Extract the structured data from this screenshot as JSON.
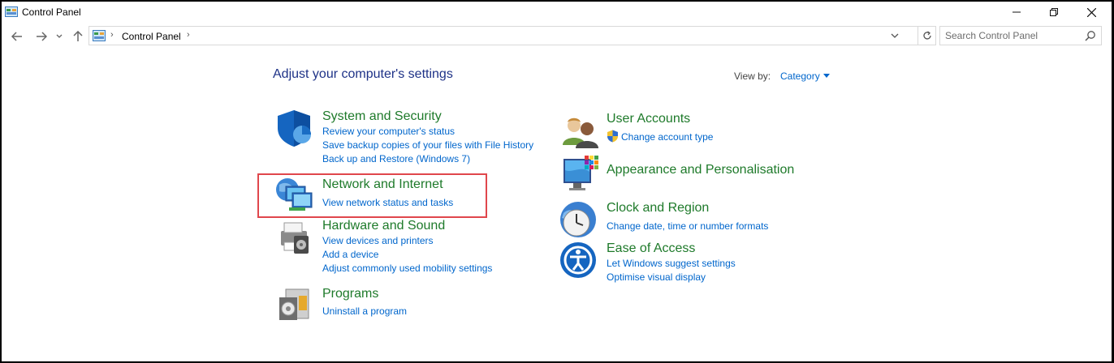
{
  "window": {
    "title": "Control Panel",
    "buttons": {
      "minimize": "—",
      "maximize": "❐",
      "close": "✕"
    }
  },
  "address": {
    "breadcrumb": [
      "Control Panel"
    ],
    "search_placeholder": "Search Control Panel"
  },
  "main": {
    "heading": "Adjust your computer's settings",
    "view_by_label": "View by:",
    "view_by_value": "Category"
  },
  "categories_left": [
    {
      "title": "System and Security",
      "icon": "shield-icon",
      "links": [
        "Review your computer's status",
        "Save backup copies of your files with File History",
        "Back up and Restore (Windows 7)"
      ]
    },
    {
      "title": "Network and Internet",
      "icon": "network-icon",
      "links": [
        "View network status and tasks"
      ]
    },
    {
      "title": "Hardware and Sound",
      "icon": "printer-icon",
      "links": [
        "View devices and printers",
        "Add a device",
        "Adjust commonly used mobility settings"
      ]
    },
    {
      "title": "Programs",
      "icon": "programs-icon",
      "links": [
        "Uninstall a program"
      ]
    }
  ],
  "categories_right": [
    {
      "title": "User Accounts",
      "icon": "users-icon",
      "links": [
        "Change account type"
      ]
    },
    {
      "title": "Appearance and Personalisation",
      "icon": "monitor-icon",
      "links": []
    },
    {
      "title": "Clock and Region",
      "icon": "clock-icon",
      "links": [
        "Change date, time or number formats"
      ]
    },
    {
      "title": "Ease of Access",
      "icon": "ease-of-access-icon",
      "links": [
        "Let Windows suggest settings",
        "Optimise visual display"
      ]
    }
  ],
  "colors": {
    "heading": "#1e3287",
    "category_title": "#1e7a2a",
    "link": "#0066cc",
    "highlight": "#e0474c"
  }
}
